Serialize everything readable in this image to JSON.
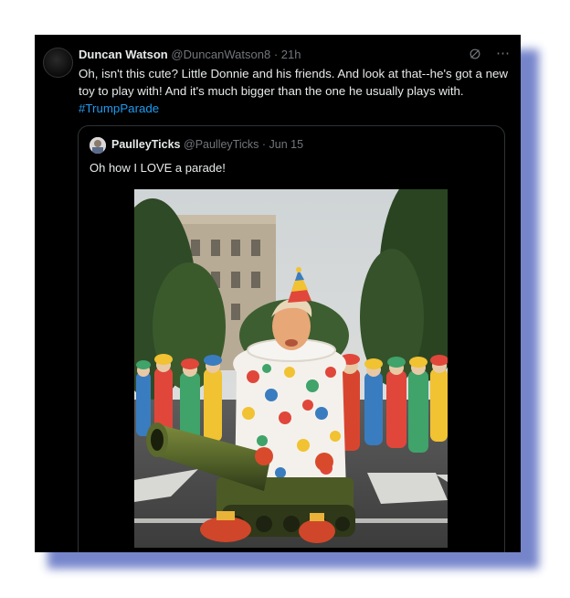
{
  "tweet": {
    "author_name": "Duncan Watson",
    "author_handle": "@DuncanWatson8",
    "time": "· 21h",
    "text": "Oh, isn't this cute? Little Donnie and his friends. And look at that--he's got a new toy to play with! And it's much bigger than the one he usually plays with.",
    "hashtag": "#TrumpParade",
    "icons": [
      "grok-icon",
      "more-icon"
    ]
  },
  "quoted": {
    "author_name": "PaulleyTicks",
    "author_handle": "@PaulleyTicks",
    "time": "· Jun 15",
    "text": "Oh how I LOVE a parade!"
  },
  "colors": {
    "card_bg": "#000000",
    "text": "#e7e9ea",
    "secondary": "#71767b",
    "link": "#1d9bf0",
    "shadow": "#6f7fc8"
  }
}
